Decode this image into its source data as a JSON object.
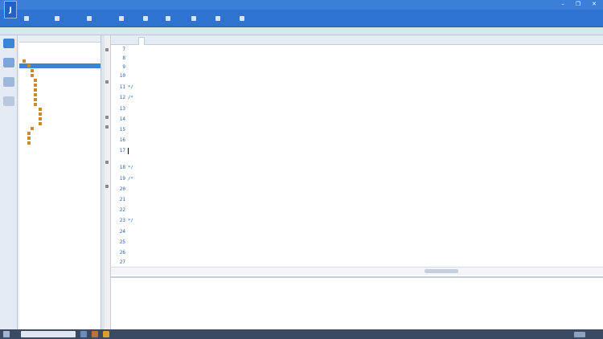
{
  "window": {
    "app_badge": "J",
    "title": "",
    "controls": [
      "–",
      "❐",
      "✕"
    ]
  },
  "toolbar": {
    "items": [
      "",
      "",
      "",
      "",
      "",
      "",
      "",
      "",
      ""
    ]
  },
  "project_panel": {
    "header": "",
    "tree": [
      {
        "label": "",
        "selected": false
      },
      {
        "label": "",
        "selected": true
      },
      {
        "label": "",
        "selected": false
      },
      {
        "label": "",
        "selected": false
      },
      {
        "label": "",
        "selected": false
      },
      {
        "label": "",
        "selected": false
      },
      {
        "label": "",
        "selected": false
      },
      {
        "label": "",
        "selected": false
      },
      {
        "label": "",
        "selected": false
      },
      {
        "label": "",
        "selected": false
      },
      {
        "label": "",
        "selected": false
      },
      {
        "label": "",
        "selected": false
      },
      {
        "label": "",
        "selected": false
      },
      {
        "label": "",
        "selected": false
      },
      {
        "label": "",
        "selected": false
      },
      {
        "label": "",
        "selected": false
      },
      {
        "label": "",
        "selected": false
      },
      {
        "label": "",
        "selected": false
      }
    ]
  },
  "editor": {
    "tabs": [
      "",
      ""
    ],
    "lines": [
      {
        "num": "7",
        "text": ""
      },
      {
        "num": "8",
        "text": ""
      },
      {
        "num": "9",
        "text": ""
      },
      {
        "num": "10",
        "text": ""
      },
      {
        "num": "11",
        "text": "*/"
      },
      {
        "num": "12",
        "text": "/*"
      },
      {
        "num": "13",
        "text": ""
      },
      {
        "num": "14",
        "text": ""
      },
      {
        "num": "15",
        "text": ""
      },
      {
        "num": "16",
        "text": ""
      },
      {
        "num": "17",
        "text": ""
      },
      {
        "num": "18",
        "text": "*/"
      },
      {
        "num": "19",
        "text": "/*"
      },
      {
        "num": "20",
        "text": ""
      },
      {
        "num": "21",
        "text": ""
      },
      {
        "num": "22",
        "text": ""
      },
      {
        "num": "23",
        "text": "*/"
      },
      {
        "num": "24",
        "text": ""
      },
      {
        "num": "25",
        "text": ""
      },
      {
        "num": "26",
        "text": ""
      },
      {
        "num": "27",
        "text": ""
      }
    ]
  },
  "console": {
    "lines": [
      "",
      "",
      "",
      ""
    ]
  },
  "colors": {
    "titlebar": "#3b7fd8",
    "toolbar": "#2f73d0",
    "code_text": "#1a60b5",
    "selection": "#3d83d6"
  }
}
